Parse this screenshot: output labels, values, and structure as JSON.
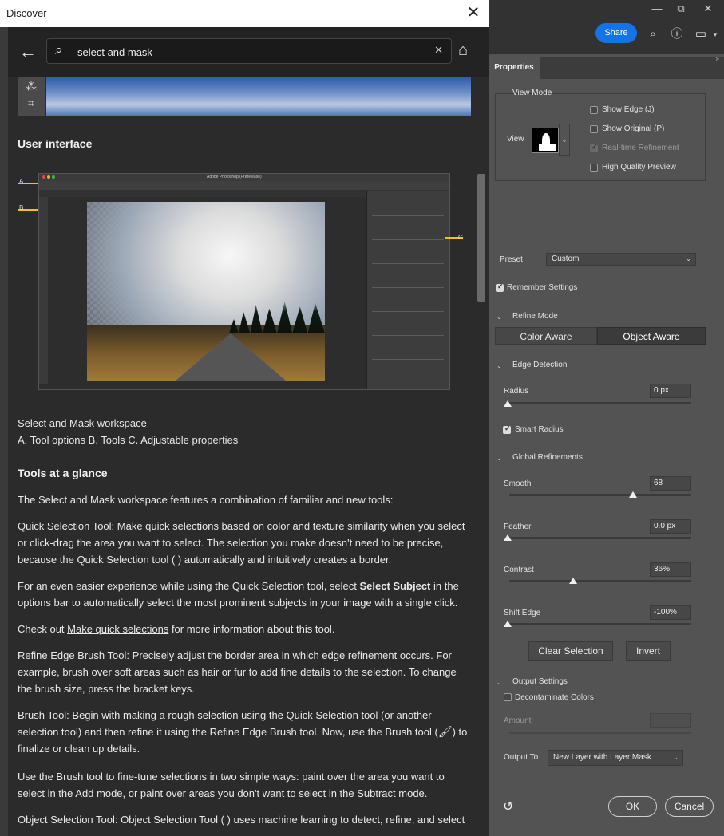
{
  "discover": {
    "title": "Discover",
    "search_value": "select and mask",
    "content": {
      "heading_ui": "User interface",
      "caption_title": "Select and Mask workspace",
      "caption_parts": "A. Tool options B. Tools C. Adjustable properties",
      "heading_tools": "Tools at a glance",
      "p1": "The Select and Mask workspace features a combination of familiar and new tools:",
      "p2": "Quick Selection Tool: Make quick selections based on color and texture similarity when you select or click-drag the area you want to select. The selection you make doesn't need to be precise, because the Quick Selection tool ( ) automatically and intuitively creates a border.",
      "p3_a": "For an even easier experience while using the Quick Selection tool, select ",
      "p3_b": "Select Subject",
      "p3_c": " in the options bar to automatically select the most prominent subjects in your image with a single click.",
      "p4_a": "Check out ",
      "p4_link": "Make quick selections",
      "p4_b": " for more information about this tool.",
      "p5": "Refine Edge Brush Tool: Precisely adjust the border area in which edge refinement occurs. For example, brush over soft areas such as hair or fur to add fine details to the selection. To change the brush size, press the bracket keys.",
      "p6_a": "Brush Tool: Begin with making a rough selection using the Quick Selection tool (or another selection tool) and then refine it using the Refine Edge Brush tool. Now, use the Brush tool (",
      "p6_b": ") to finalize or clean up details.",
      "p7": "Use the Brush tool to fine-tune selections in two simple ways: paint over the area you want to select in the Add mode, or paint over areas you don't want to select in the Subtract mode.",
      "p8": "Object Selection Tool: Object Selection Tool ( ) uses machine learning to detect, refine, and select"
    },
    "screenshot_title": "Adobe Photoshop (Prerelease)"
  },
  "toolbar": {
    "share_label": "Share"
  },
  "properties": {
    "tab": "Properties",
    "view_mode_label": "View Mode",
    "view_label": "View",
    "show_edge": "Show Edge (J)",
    "show_original": "Show Original (P)",
    "realtime_refinement": "Real-time Refinement",
    "high_quality_preview": "High Quality Preview",
    "preset_label": "Preset",
    "preset_value": "Custom",
    "remember_settings": "Remember Settings",
    "refine_mode_label": "Refine Mode",
    "color_aware": "Color Aware",
    "object_aware": "Object Aware",
    "edge_detection_label": "Edge Detection",
    "radius_label": "Radius",
    "radius_value": "0 px",
    "smart_radius": "Smart Radius",
    "global_refinements_label": "Global Refinements",
    "smooth_label": "Smooth",
    "smooth_value": "68",
    "feather_label": "Feather",
    "feather_value": "0.0 px",
    "contrast_label": "Contrast",
    "contrast_value": "36%",
    "shift_edge_label": "Shift Edge",
    "shift_edge_value": "-100%",
    "clear_selection": "Clear Selection",
    "invert": "Invert",
    "output_settings_label": "Output Settings",
    "decontaminate_colors": "Decontaminate Colors",
    "amount_label": "Amount",
    "output_to_label": "Output To",
    "output_to_value": "New Layer with Layer Mask",
    "ok": "OK",
    "cancel": "Cancel"
  },
  "icons": {
    "back": "arrow-left-icon",
    "search": "search-icon",
    "clear": "close-icon",
    "home": "home-icon",
    "help": "help-icon",
    "workspace": "workspace-icon",
    "reset": "reset-icon"
  },
  "colors": {
    "accent": "#1473e6",
    "panel": "#535353",
    "callout": "#f5c500"
  }
}
